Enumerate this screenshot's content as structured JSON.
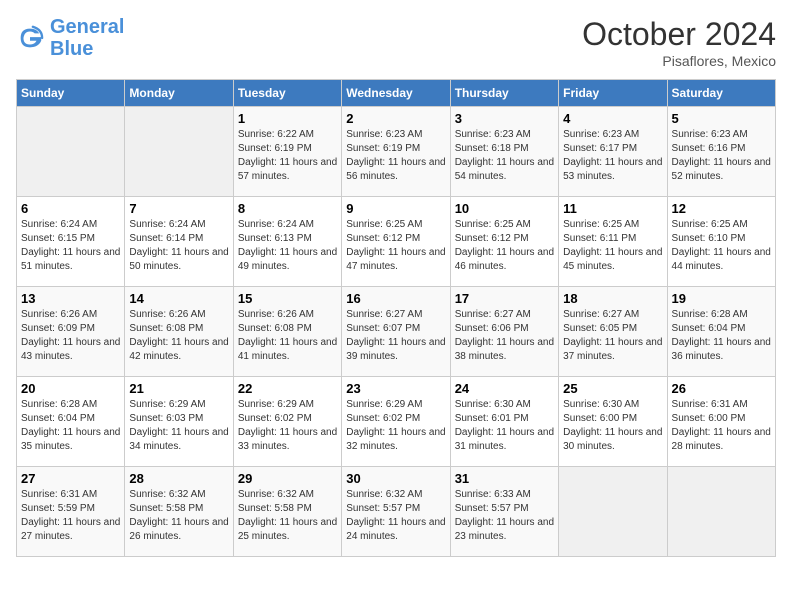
{
  "header": {
    "logo_general": "General",
    "logo_blue": "Blue",
    "month_title": "October 2024",
    "location": "Pisaflores, Mexico"
  },
  "days_of_week": [
    "Sunday",
    "Monday",
    "Tuesday",
    "Wednesday",
    "Thursday",
    "Friday",
    "Saturday"
  ],
  "weeks": [
    [
      {
        "day": "",
        "sunrise": "",
        "sunset": "",
        "daylight": ""
      },
      {
        "day": "",
        "sunrise": "",
        "sunset": "",
        "daylight": ""
      },
      {
        "day": "1",
        "sunrise": "Sunrise: 6:22 AM",
        "sunset": "Sunset: 6:19 PM",
        "daylight": "Daylight: 11 hours and 57 minutes."
      },
      {
        "day": "2",
        "sunrise": "Sunrise: 6:23 AM",
        "sunset": "Sunset: 6:19 PM",
        "daylight": "Daylight: 11 hours and 56 minutes."
      },
      {
        "day": "3",
        "sunrise": "Sunrise: 6:23 AM",
        "sunset": "Sunset: 6:18 PM",
        "daylight": "Daylight: 11 hours and 54 minutes."
      },
      {
        "day": "4",
        "sunrise": "Sunrise: 6:23 AM",
        "sunset": "Sunset: 6:17 PM",
        "daylight": "Daylight: 11 hours and 53 minutes."
      },
      {
        "day": "5",
        "sunrise": "Sunrise: 6:23 AM",
        "sunset": "Sunset: 6:16 PM",
        "daylight": "Daylight: 11 hours and 52 minutes."
      }
    ],
    [
      {
        "day": "6",
        "sunrise": "Sunrise: 6:24 AM",
        "sunset": "Sunset: 6:15 PM",
        "daylight": "Daylight: 11 hours and 51 minutes."
      },
      {
        "day": "7",
        "sunrise": "Sunrise: 6:24 AM",
        "sunset": "Sunset: 6:14 PM",
        "daylight": "Daylight: 11 hours and 50 minutes."
      },
      {
        "day": "8",
        "sunrise": "Sunrise: 6:24 AM",
        "sunset": "Sunset: 6:13 PM",
        "daylight": "Daylight: 11 hours and 49 minutes."
      },
      {
        "day": "9",
        "sunrise": "Sunrise: 6:25 AM",
        "sunset": "Sunset: 6:12 PM",
        "daylight": "Daylight: 11 hours and 47 minutes."
      },
      {
        "day": "10",
        "sunrise": "Sunrise: 6:25 AM",
        "sunset": "Sunset: 6:12 PM",
        "daylight": "Daylight: 11 hours and 46 minutes."
      },
      {
        "day": "11",
        "sunrise": "Sunrise: 6:25 AM",
        "sunset": "Sunset: 6:11 PM",
        "daylight": "Daylight: 11 hours and 45 minutes."
      },
      {
        "day": "12",
        "sunrise": "Sunrise: 6:25 AM",
        "sunset": "Sunset: 6:10 PM",
        "daylight": "Daylight: 11 hours and 44 minutes."
      }
    ],
    [
      {
        "day": "13",
        "sunrise": "Sunrise: 6:26 AM",
        "sunset": "Sunset: 6:09 PM",
        "daylight": "Daylight: 11 hours and 43 minutes."
      },
      {
        "day": "14",
        "sunrise": "Sunrise: 6:26 AM",
        "sunset": "Sunset: 6:08 PM",
        "daylight": "Daylight: 11 hours and 42 minutes."
      },
      {
        "day": "15",
        "sunrise": "Sunrise: 6:26 AM",
        "sunset": "Sunset: 6:08 PM",
        "daylight": "Daylight: 11 hours and 41 minutes."
      },
      {
        "day": "16",
        "sunrise": "Sunrise: 6:27 AM",
        "sunset": "Sunset: 6:07 PM",
        "daylight": "Daylight: 11 hours and 39 minutes."
      },
      {
        "day": "17",
        "sunrise": "Sunrise: 6:27 AM",
        "sunset": "Sunset: 6:06 PM",
        "daylight": "Daylight: 11 hours and 38 minutes."
      },
      {
        "day": "18",
        "sunrise": "Sunrise: 6:27 AM",
        "sunset": "Sunset: 6:05 PM",
        "daylight": "Daylight: 11 hours and 37 minutes."
      },
      {
        "day": "19",
        "sunrise": "Sunrise: 6:28 AM",
        "sunset": "Sunset: 6:04 PM",
        "daylight": "Daylight: 11 hours and 36 minutes."
      }
    ],
    [
      {
        "day": "20",
        "sunrise": "Sunrise: 6:28 AM",
        "sunset": "Sunset: 6:04 PM",
        "daylight": "Daylight: 11 hours and 35 minutes."
      },
      {
        "day": "21",
        "sunrise": "Sunrise: 6:29 AM",
        "sunset": "Sunset: 6:03 PM",
        "daylight": "Daylight: 11 hours and 34 minutes."
      },
      {
        "day": "22",
        "sunrise": "Sunrise: 6:29 AM",
        "sunset": "Sunset: 6:02 PM",
        "daylight": "Daylight: 11 hours and 33 minutes."
      },
      {
        "day": "23",
        "sunrise": "Sunrise: 6:29 AM",
        "sunset": "Sunset: 6:02 PM",
        "daylight": "Daylight: 11 hours and 32 minutes."
      },
      {
        "day": "24",
        "sunrise": "Sunrise: 6:30 AM",
        "sunset": "Sunset: 6:01 PM",
        "daylight": "Daylight: 11 hours and 31 minutes."
      },
      {
        "day": "25",
        "sunrise": "Sunrise: 6:30 AM",
        "sunset": "Sunset: 6:00 PM",
        "daylight": "Daylight: 11 hours and 30 minutes."
      },
      {
        "day": "26",
        "sunrise": "Sunrise: 6:31 AM",
        "sunset": "Sunset: 6:00 PM",
        "daylight": "Daylight: 11 hours and 28 minutes."
      }
    ],
    [
      {
        "day": "27",
        "sunrise": "Sunrise: 6:31 AM",
        "sunset": "Sunset: 5:59 PM",
        "daylight": "Daylight: 11 hours and 27 minutes."
      },
      {
        "day": "28",
        "sunrise": "Sunrise: 6:32 AM",
        "sunset": "Sunset: 5:58 PM",
        "daylight": "Daylight: 11 hours and 26 minutes."
      },
      {
        "day": "29",
        "sunrise": "Sunrise: 6:32 AM",
        "sunset": "Sunset: 5:58 PM",
        "daylight": "Daylight: 11 hours and 25 minutes."
      },
      {
        "day": "30",
        "sunrise": "Sunrise: 6:32 AM",
        "sunset": "Sunset: 5:57 PM",
        "daylight": "Daylight: 11 hours and 24 minutes."
      },
      {
        "day": "31",
        "sunrise": "Sunrise: 6:33 AM",
        "sunset": "Sunset: 5:57 PM",
        "daylight": "Daylight: 11 hours and 23 minutes."
      },
      {
        "day": "",
        "sunrise": "",
        "sunset": "",
        "daylight": ""
      },
      {
        "day": "",
        "sunrise": "",
        "sunset": "",
        "daylight": ""
      }
    ]
  ]
}
